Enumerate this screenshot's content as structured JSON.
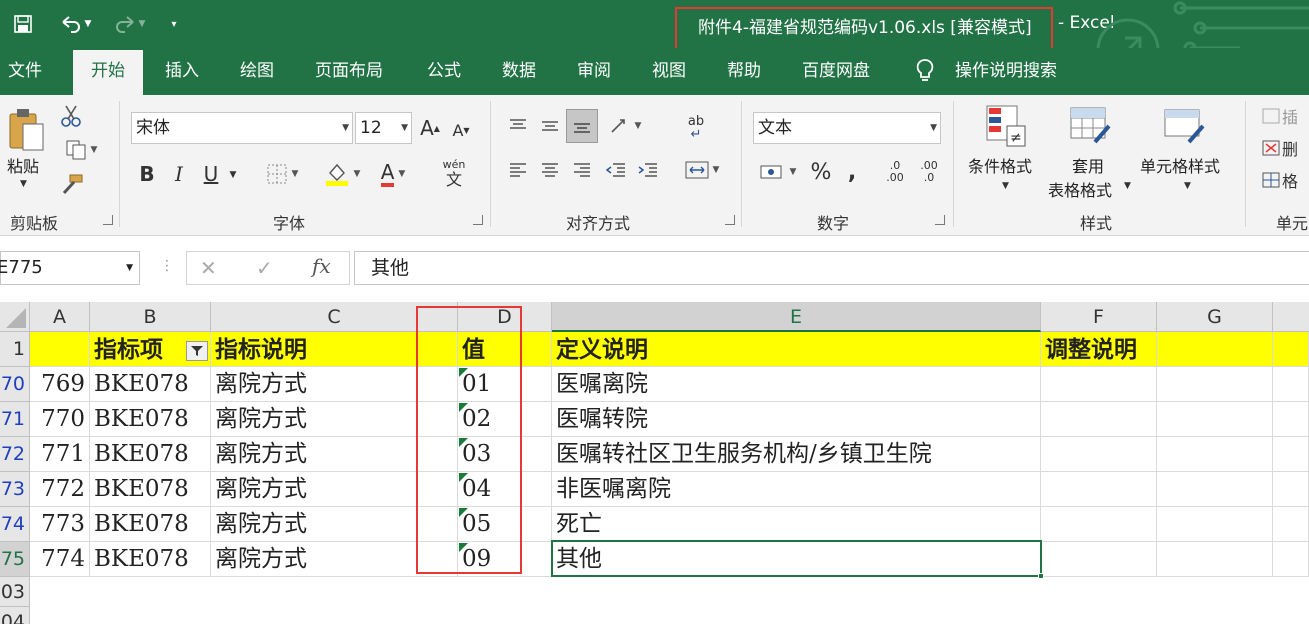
{
  "window": {
    "title": "附件4-福建省规范编码v1.06.xls  [兼容模式]",
    "app_suffix": "-  Excel"
  },
  "quick_access": {
    "save_icon": "save-icon",
    "undo_icon": "undo-icon",
    "redo_icon": "redo-icon",
    "customize_icon": "customize-icon"
  },
  "menu": {
    "file": "文件",
    "home": "开始",
    "insert": "插入",
    "draw": "绘图",
    "layout": "页面布局",
    "formulas": "公式",
    "data": "数据",
    "review": "审阅",
    "view": "视图",
    "help": "帮助",
    "baidu": "百度网盘",
    "tell_me": "操作说明搜索"
  },
  "ribbon": {
    "clipboard": {
      "paste": "粘贴",
      "group": "剪贴板"
    },
    "font": {
      "name": "宋体",
      "size": "12",
      "bold": "B",
      "italic": "I",
      "underline": "U",
      "grow": "A",
      "shrink": "A",
      "font_color": "A",
      "phonetic_top": "wén",
      "phonetic_bottom": "文",
      "group": "字体"
    },
    "alignment": {
      "group": "对齐方式",
      "orient": "ab"
    },
    "number": {
      "format": "文本",
      "percent": "%",
      "comma": ",",
      "group": "数字",
      "inc_dec": ".0 .00",
      "dec_dec": ".00 .0"
    },
    "styles": {
      "conditional": "条件格式",
      "table_top": "套用",
      "table_bottom": "表格格式",
      "cell_styles": "单元格样式",
      "group": "样式"
    },
    "cells": {
      "insert": "插",
      "delete": "删",
      "format": "格",
      "group": "单元"
    }
  },
  "formula_bar": {
    "name_box": "E775",
    "cancel": "✕",
    "enter": "✓",
    "fx": "fx",
    "content": "其他"
  },
  "columns": [
    "A",
    "B",
    "C",
    "D",
    "E",
    "F",
    "G"
  ],
  "header_row": {
    "row": "1",
    "b": "指标项",
    "c": "指标说明",
    "d": "值",
    "e": "定义说明",
    "f": "调整说明"
  },
  "rows": [
    {
      "row": "70",
      "a": "769",
      "b": "BKE078",
      "c": "离院方式",
      "d": "01",
      "e": "医嘱离院"
    },
    {
      "row": "71",
      "a": "770",
      "b": "BKE078",
      "c": "离院方式",
      "d": "02",
      "e": "医嘱转院"
    },
    {
      "row": "72",
      "a": "771",
      "b": "BKE078",
      "c": "离院方式",
      "d": "03",
      "e": "医嘱转社区卫生服务机构/乡镇卫生院"
    },
    {
      "row": "73",
      "a": "772",
      "b": "BKE078",
      "c": "离院方式",
      "d": "04",
      "e": "非医嘱离院"
    },
    {
      "row": "74",
      "a": "773",
      "b": "BKE078",
      "c": "离院方式",
      "d": "05",
      "e": "死亡"
    },
    {
      "row": "75",
      "a": "774",
      "b": "BKE078",
      "c": "离院方式",
      "d": "09",
      "e": "其他"
    }
  ],
  "extra_rows": [
    "03",
    "04"
  ],
  "colors": {
    "excel_green": "#217346",
    "highlight_yellow": "#ffff00",
    "annotation_red": "#e53935"
  }
}
